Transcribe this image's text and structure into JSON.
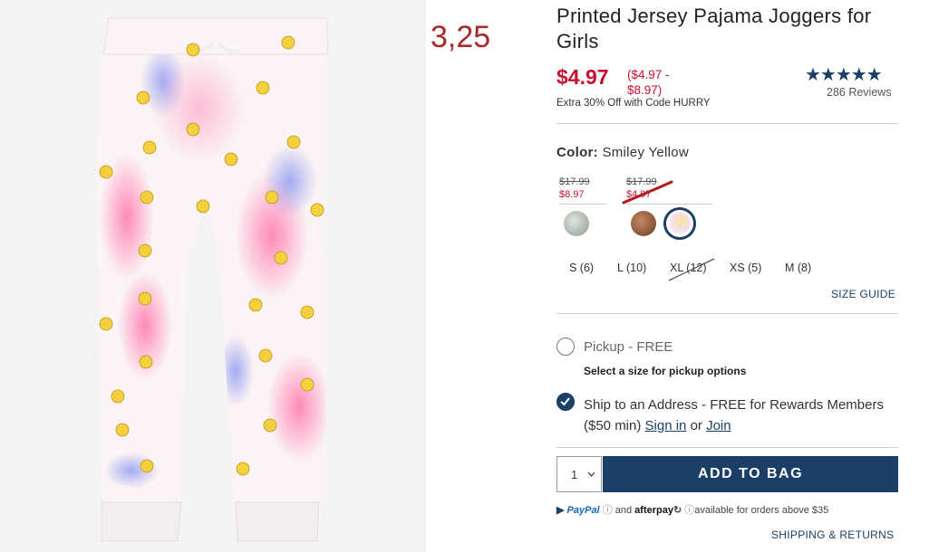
{
  "annotation": {
    "text": "3,25",
    "color": "#a52a2a"
  },
  "product": {
    "title": "Printed Jersey Pajama Joggers for Girls",
    "sale_price": "$4.97",
    "price_range": "($4.97 - $8.97)",
    "promo": "Extra 30% Off with Code HURRY",
    "rating_stars": "★★★★★",
    "rating_value": 5,
    "reviews": "286 Reviews"
  },
  "color": {
    "label": "Color:",
    "selected": "Smiley Yellow",
    "groups": [
      {
        "original": "$17.99",
        "sale": "$8.97"
      },
      {
        "original": "$17.99",
        "sale": "$4.97"
      }
    ],
    "swatches": [
      "silver-sparkle",
      "bronze-sparkle",
      "smiley-yellow"
    ]
  },
  "sizes": [
    {
      "label": "S (6)",
      "available": true
    },
    {
      "label": "L (10)",
      "available": true
    },
    {
      "label": "XL (12)",
      "available": false
    },
    {
      "label": "XS (5)",
      "available": true
    },
    {
      "label": "M (8)",
      "available": true
    }
  ],
  "size_guide": "SIZE GUIDE",
  "fulfillment": {
    "pickup": {
      "label": "Pickup - FREE",
      "hint": "Select a size for pickup options",
      "checked": false
    },
    "ship": {
      "label_prefix": "Ship to an Address - FREE for Rewards Members ($50 min)",
      "sign_in": "Sign in",
      "or": "or",
      "join": "Join",
      "checked": true
    }
  },
  "quantity": {
    "value": "1"
  },
  "add_to_bag": "ADD TO BAG",
  "payment": {
    "paypal": "PayPal",
    "and": "and",
    "afterpay": "afterpay",
    "note": "available for orders above $35"
  },
  "shipping_returns": "SHIPPING & RETURNS",
  "colors": {
    "brand_navy": "#1b3f66",
    "sale_red": "#c8102e"
  }
}
